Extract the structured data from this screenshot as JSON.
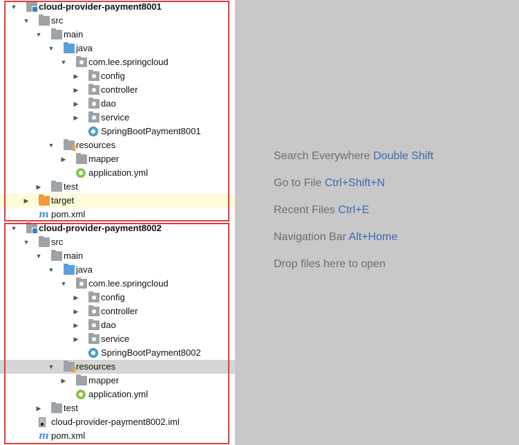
{
  "project_tree": {
    "rows": [
      {
        "label": "cloud-provider-payment8001",
        "arrow": "▼",
        "icon": "module-folder-icon",
        "bold": true
      },
      {
        "label": "src",
        "arrow": "▼",
        "icon": "folder-icon"
      },
      {
        "label": "main",
        "arrow": "▼",
        "icon": "folder-icon"
      },
      {
        "label": "java",
        "arrow": "▼",
        "icon": "source-folder-icon"
      },
      {
        "label": "com.lee.springcloud",
        "arrow": "▼",
        "icon": "package-icon"
      },
      {
        "label": "config",
        "arrow": "▶",
        "icon": "package-icon"
      },
      {
        "label": "controller",
        "arrow": "▶",
        "icon": "package-icon"
      },
      {
        "label": "dao",
        "arrow": "▶",
        "icon": "package-icon"
      },
      {
        "label": "service",
        "arrow": "▶",
        "icon": "package-icon"
      },
      {
        "label": "SpringBootPayment8001",
        "arrow": "",
        "icon": "spring-class-icon"
      },
      {
        "label": "resources",
        "arrow": "▼",
        "icon": "resources-folder-icon"
      },
      {
        "label": "mapper",
        "arrow": "▶",
        "icon": "folder-icon"
      },
      {
        "label": "application.yml",
        "arrow": "",
        "icon": "yml-file-icon"
      },
      {
        "label": "test",
        "arrow": "▶",
        "icon": "folder-icon"
      },
      {
        "label": "target",
        "arrow": "▶",
        "icon": "excluded-folder-icon",
        "highlight": "yellow"
      },
      {
        "label": "pom.xml",
        "arrow": "",
        "icon": "maven-icon"
      },
      {
        "label": "cloud-provider-payment8002",
        "arrow": "▼",
        "icon": "module-folder-icon",
        "bold": true
      },
      {
        "label": "src",
        "arrow": "▼",
        "icon": "folder-icon"
      },
      {
        "label": "main",
        "arrow": "▼",
        "icon": "folder-icon"
      },
      {
        "label": "java",
        "arrow": "▼",
        "icon": "source-folder-icon"
      },
      {
        "label": "com.lee.springcloud",
        "arrow": "▼",
        "icon": "package-icon"
      },
      {
        "label": "config",
        "arrow": "▶",
        "icon": "package-icon"
      },
      {
        "label": "controller",
        "arrow": "▶",
        "icon": "package-icon"
      },
      {
        "label": "dao",
        "arrow": "▶",
        "icon": "package-icon"
      },
      {
        "label": "service",
        "arrow": "▶",
        "icon": "package-icon"
      },
      {
        "label": "SpringBootPayment8002",
        "arrow": "",
        "icon": "spring-class-icon"
      },
      {
        "label": "resources",
        "arrow": "▼",
        "icon": "resources-folder-icon",
        "highlight": "gray"
      },
      {
        "label": "mapper",
        "arrow": "▶",
        "icon": "folder-icon"
      },
      {
        "label": "application.yml",
        "arrow": "",
        "icon": "yml-file-icon"
      },
      {
        "label": "test",
        "arrow": "▶",
        "icon": "folder-icon"
      },
      {
        "label": "cloud-provider-payment8002.iml",
        "arrow": "",
        "icon": "iml-file-icon"
      },
      {
        "label": "pom.xml",
        "arrow": "",
        "icon": "maven-icon"
      }
    ]
  },
  "editor_hints": [
    {
      "text": "Search Everywhere",
      "shortcut": "Double Shift"
    },
    {
      "text": "Go to File",
      "shortcut": "Ctrl+Shift+N"
    },
    {
      "text": "Recent Files",
      "shortcut": "Ctrl+E"
    },
    {
      "text": "Navigation Bar",
      "shortcut": "Alt+Home"
    },
    {
      "text": "Drop files here to open",
      "shortcut": ""
    }
  ],
  "colors": {
    "annotation_box": "#e03b3b",
    "shortcut": "#3b6bb0",
    "hint_text": "#6e6e6e",
    "editor_bg": "#c8c8c8"
  }
}
